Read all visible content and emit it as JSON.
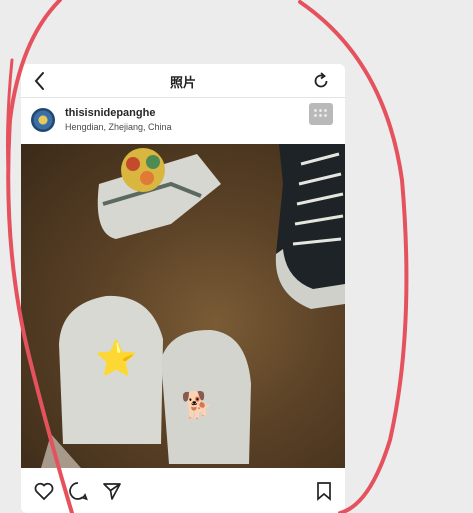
{
  "navbar": {
    "title": "照片",
    "back_icon": "chevron-left-icon",
    "refresh_icon": "refresh-icon"
  },
  "post": {
    "username": "thisisnidepanghe",
    "location": "Hengdian, Zhejiang, China",
    "more_icon": "more-icon"
  },
  "photo": {
    "description_icons": [
      "star-struck-emoji",
      "shiba-emoji"
    ],
    "emoji_star": "⭐",
    "emoji_dog": "🐕"
  },
  "actions": {
    "like_icon": "heart-icon",
    "comment_icon": "comment-icon",
    "share_icon": "send-icon",
    "save_icon": "bookmark-icon"
  },
  "annotation": {
    "color": "#e5525e"
  }
}
